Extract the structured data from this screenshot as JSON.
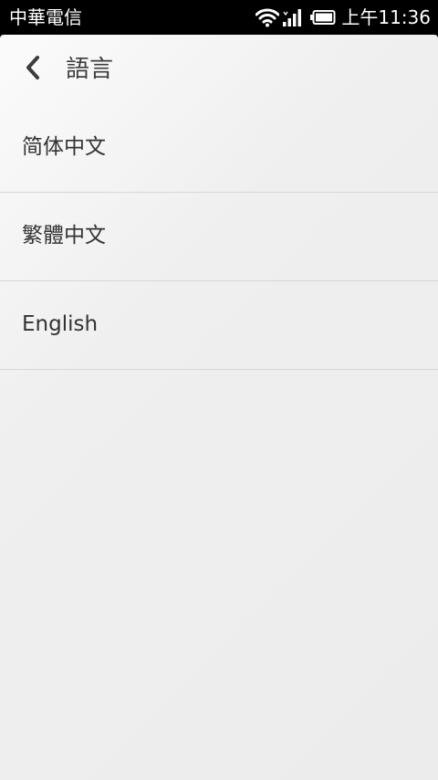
{
  "status_bar": {
    "carrier": "中華電信",
    "time": "上午11:36",
    "icons": [
      "wifi-icon",
      "signal-icon",
      "battery-icon"
    ]
  },
  "header": {
    "back_icon": "chevron-left-icon",
    "title": "語言"
  },
  "languages": [
    {
      "label": "简体中文"
    },
    {
      "label": "繁體中文"
    },
    {
      "label": "English"
    }
  ],
  "colors": {
    "background": "#ececec",
    "text": "#333333",
    "divider": "#d6d6d6",
    "status_bar": "#000000"
  }
}
